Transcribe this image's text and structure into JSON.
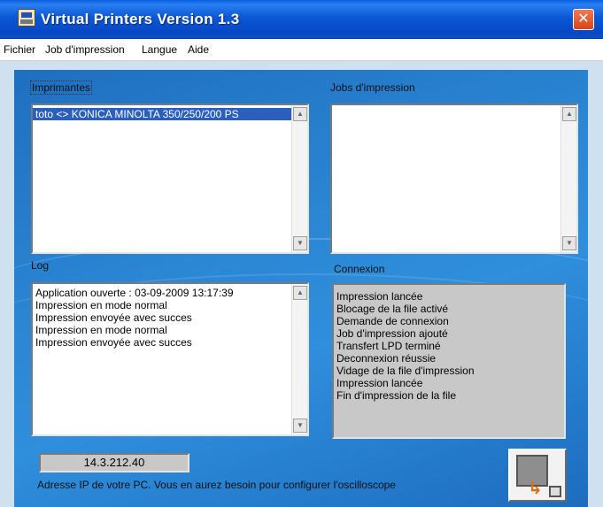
{
  "window": {
    "title": "Virtual Printers Version 1.3",
    "close_glyph": "✕"
  },
  "menu": {
    "items": [
      "Fichier",
      "Job d'impression",
      "Langue",
      "Aide"
    ]
  },
  "printers": {
    "label": "Imprimantes",
    "items": [
      "toto <> KONICA MINOLTA 350/250/200 PS"
    ],
    "selected_index": 0
  },
  "jobs": {
    "label": "Jobs d'impression",
    "items": []
  },
  "log": {
    "label": "Log",
    "lines": [
      "Application ouverte : 03-09-2009  13:17:39",
      "Impression en mode normal",
      "Impression envoyée avec succes",
      "Impression en mode normal",
      "Impression envoyée avec succes"
    ]
  },
  "connexion": {
    "label": "Connexion",
    "lines": [
      "Impression lancée",
      "Blocage de la file activé",
      "Demande de connexion",
      "Job d'impression ajouté",
      "Transfert LPD terminé",
      "Deconnexion réussie",
      "Vidage de la file d'impression",
      "Impression lancée",
      "Fin d'impression de la file"
    ]
  },
  "ip": {
    "value": "14.3.212.40",
    "caption": "Adresse IP de votre PC. Vous en aurez besoin pour configurer l'oscilloscope"
  },
  "icons": {
    "scroll_up": "▲",
    "scroll_down": "▼",
    "action_arrow": "↳"
  },
  "colors": {
    "title_bar": "#0b58d6",
    "client_bg": "#2b86d4",
    "selection": "#2b5fbd",
    "close_button": "#d84416"
  }
}
